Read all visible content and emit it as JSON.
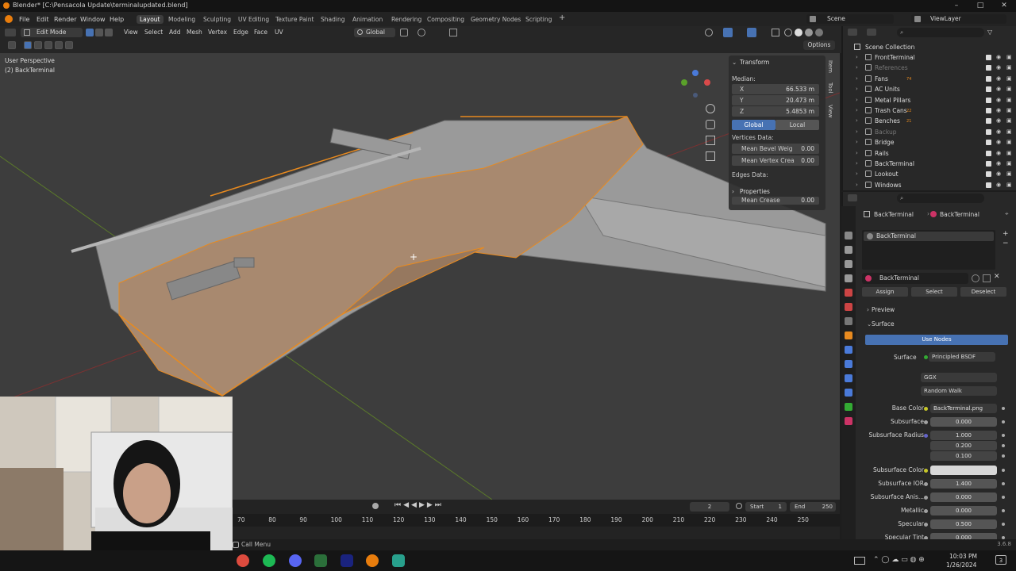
{
  "title_bar": {
    "text": "Blender* [C:\\Pensacola Update\\terminalupdated.blend]",
    "minimize": "–",
    "maximize": "□",
    "close": "✕"
  },
  "menu": {
    "items": [
      "File",
      "Edit",
      "Render",
      "Window",
      "Help"
    ]
  },
  "workspaces": {
    "tabs": [
      "Layout",
      "Modeling",
      "Sculpting",
      "UV Editing",
      "Texture Paint",
      "Shading",
      "Animation",
      "Rendering",
      "Compositing",
      "Geometry Nodes",
      "Scripting"
    ],
    "add": "+"
  },
  "scene": {
    "scene_name": "Scene",
    "view_layer": "ViewLayer"
  },
  "viewport_header": {
    "mode": "Edit Mode",
    "menus": [
      "View",
      "Select",
      "Add",
      "Mesh",
      "Vertex",
      "Edge",
      "Face",
      "UV"
    ],
    "orientation": "Global",
    "options": "Options"
  },
  "viewport": {
    "perspective": "User Perspective",
    "object_label": "(2) BackTerminal"
  },
  "n_panel": {
    "transform_label": "Transform",
    "median_label": "Median:",
    "x_label": "X",
    "x_value": "66.533 m",
    "y_label": "Y",
    "y_value": "20.473 m",
    "z_label": "Z",
    "z_value": "5.4853 m",
    "global": "Global",
    "local": "Local",
    "vertices_data": "Vertices Data:",
    "mean_bevel_label": "Mean Bevel Weig",
    "mean_bevel_value": "0.00",
    "mean_vertex_crease_label": "Mean Vertex Crea",
    "mean_vertex_crease_value": "0.00",
    "edges_data": "Edges Data:",
    "properties_label": "Properties",
    "mean_crease_label": "Mean Crease",
    "mean_crease_value": "0.00",
    "tabs": [
      "Item",
      "Tool",
      "View"
    ]
  },
  "outliner": {
    "root": "Scene Collection",
    "items": [
      {
        "name": "FrontTerminal",
        "dim": false
      },
      {
        "name": "References",
        "dim": true
      },
      {
        "name": "Fans",
        "dim": false
      },
      {
        "name": "AC Units",
        "dim": false
      },
      {
        "name": "Metal Pillars",
        "dim": false
      },
      {
        "name": "Trash Cans",
        "dim": false
      },
      {
        "name": "Benches",
        "dim": false
      },
      {
        "name": "Backup",
        "dim": true
      },
      {
        "name": "Bridge",
        "dim": false
      },
      {
        "name": "Rails",
        "dim": false
      },
      {
        "name": "BackTerminal",
        "dim": false
      },
      {
        "name": "Lookout",
        "dim": false
      },
      {
        "name": "Windows",
        "dim": false
      }
    ],
    "badges": [
      "74",
      "22",
      "21"
    ]
  },
  "properties": {
    "breadcrumb_object": "BackTerminal",
    "breadcrumb_material": "BackTerminal",
    "slot_name": "BackTerminal",
    "material_name": "BackTerminal",
    "assign": "Assign",
    "select": "Select",
    "deselect": "Deselect",
    "preview": "Preview",
    "surface_section": "Surface",
    "use_nodes": "Use Nodes",
    "surface_label": "Surface",
    "surface_value": "Principled BSDF",
    "distribution": "GGX",
    "subsurface_method": "Random Walk",
    "rows": [
      {
        "label": "Base Color",
        "value": "BackTerminal.png"
      },
      {
        "label": "Subsurface",
        "value": "0.000"
      },
      {
        "label": "Subsurface Radius",
        "value": "1.000"
      },
      {
        "label": "",
        "value": "0.200"
      },
      {
        "label": "",
        "value": "0.100"
      },
      {
        "label": "Subsurface Color",
        "value": ""
      },
      {
        "label": "Subsurface IOR",
        "value": "1.400"
      },
      {
        "label": "Subsurface Anis...",
        "value": "0.000"
      },
      {
        "label": "Metallic",
        "value": "0.000"
      },
      {
        "label": "Specular",
        "value": "0.500"
      },
      {
        "label": "Specular Tint",
        "value": "0.000"
      }
    ]
  },
  "timeline": {
    "current_frame": "2",
    "start_label": "Start",
    "start_value": "1",
    "end_label": "End",
    "end_value": "250",
    "ruler": [
      "70",
      "80",
      "90",
      "100",
      "110",
      "120",
      "130",
      "140",
      "150",
      "160",
      "170",
      "180",
      "190",
      "200",
      "210",
      "220",
      "230",
      "240",
      "250"
    ]
  },
  "status_bar": {
    "left": "Call Menu",
    "version": "3.6.8"
  },
  "taskbar": {
    "time": "10:03 PM",
    "date": "1/26/2024",
    "notifications": "3"
  }
}
